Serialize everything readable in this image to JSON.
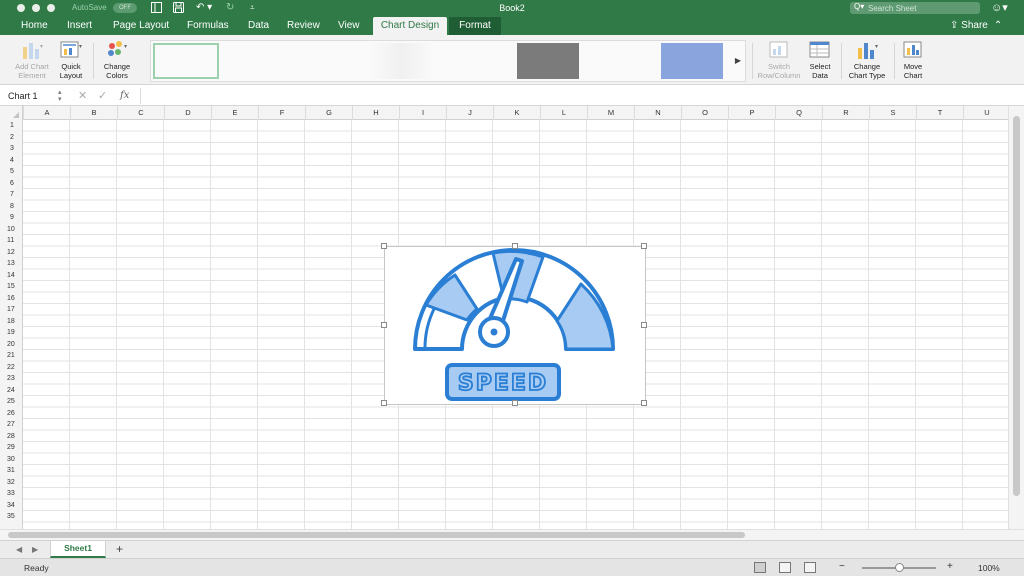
{
  "titlebar": {
    "autosave_label": "AutoSave",
    "autosave_state": "OFF",
    "title": "Book2",
    "search_placeholder": "Search Sheet",
    "qa_icons": [
      "sidebar-icon",
      "save-icon",
      "undo-icon",
      "redo-icon",
      "customize-icon"
    ]
  },
  "tabs": [
    {
      "label": "Home"
    },
    {
      "label": "Insert"
    },
    {
      "label": "Page Layout"
    },
    {
      "label": "Formulas"
    },
    {
      "label": "Data"
    },
    {
      "label": "Review"
    },
    {
      "label": "View"
    },
    {
      "label": "Chart Design",
      "active": true
    },
    {
      "label": "Format"
    }
  ],
  "share_label": "Share",
  "ribbon": {
    "add_chart_element": "Add Chart\nElement",
    "quick_layout": "Quick\nLayout",
    "change_colors": "Change\nColors",
    "switch_row_column": "Switch\nRow/Column",
    "select_data": "Select\nData",
    "change_chart_type": "Change\nChart Type",
    "move_chart": "Move\nChart",
    "style_colors": [
      "#ffffff",
      "#ffffff",
      "#ffffff",
      "#ffffff",
      "#7b7b7b",
      "#ffffff",
      "#8aa4dd",
      "#ffffff"
    ]
  },
  "formula": {
    "namebox": "Chart 1",
    "fx_label": "fx",
    "value": ""
  },
  "columns": [
    "A",
    "B",
    "C",
    "D",
    "E",
    "F",
    "G",
    "H",
    "I",
    "J",
    "K",
    "L",
    "M",
    "N",
    "O",
    "P",
    "Q",
    "R",
    "S",
    "T",
    "U"
  ],
  "rows": [
    "1",
    "2",
    "3",
    "4",
    "5",
    "6",
    "7",
    "8",
    "9",
    "10",
    "11",
    "12",
    "13",
    "14",
    "15",
    "16",
    "17",
    "18",
    "19",
    "20",
    "21",
    "22",
    "23",
    "24",
    "25",
    "26",
    "27",
    "28",
    "29",
    "30",
    "31",
    "32",
    "33",
    "34",
    "35"
  ],
  "chart": {
    "gauge_label": "SPEED",
    "primary_color": "#2a7fd4",
    "fill_color": "#a7cbf2",
    "icon": "speedometer-icon"
  },
  "sheet": {
    "tab_label": "Sheet1",
    "add_label": "+"
  },
  "status": {
    "ready": "Ready",
    "zoom": "100%",
    "zoom_minus": "−",
    "zoom_plus": "+"
  }
}
